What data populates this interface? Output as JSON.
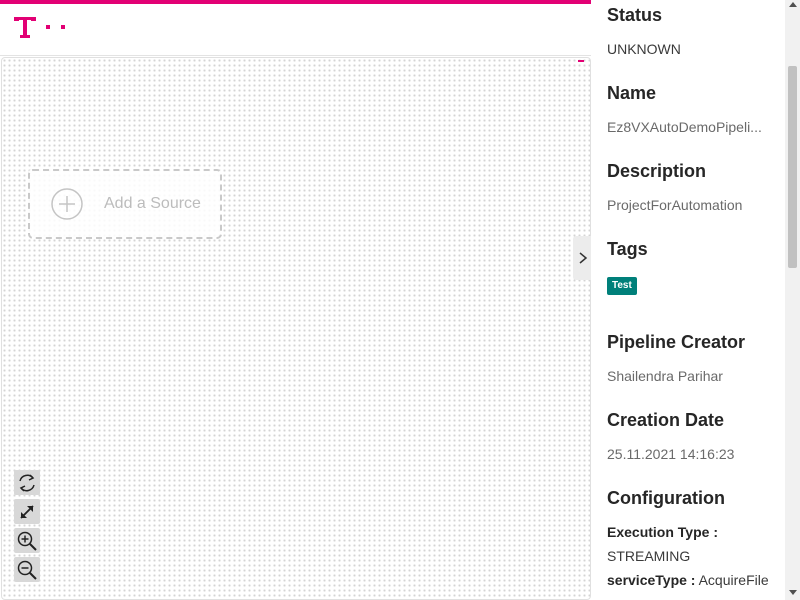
{
  "brand": {
    "logo_icon": "telekom-t-logo",
    "accent_color": "#e20074"
  },
  "canvas": {
    "add_source_label": "Add a Source",
    "toolbar": [
      {
        "icon": "reset-rotate-icon"
      },
      {
        "icon": "fit-view-icon"
      },
      {
        "icon": "zoom-in-icon"
      },
      {
        "icon": "zoom-out-icon"
      }
    ]
  },
  "details": {
    "status": {
      "title": "Status",
      "value": "UNKNOWN"
    },
    "name": {
      "title": "Name",
      "value": "Ez8VXAutoDemoPipeli..."
    },
    "description": {
      "title": "Description",
      "value": "ProjectForAutomation"
    },
    "tags": {
      "title": "Tags",
      "items": [
        "Test"
      ],
      "tag_color": "#00807a"
    },
    "creator": {
      "title": "Pipeline Creator",
      "value": "Shailendra Parihar"
    },
    "creation_date": {
      "title": "Creation Date",
      "value": "25.11.2021 14:16:23"
    },
    "configuration": {
      "title": "Configuration",
      "execution_type_key": "Execution Type :",
      "execution_type_value": "STREAMING",
      "service_type_key": "serviceType :",
      "service_type_value": "AcquireFile"
    }
  }
}
